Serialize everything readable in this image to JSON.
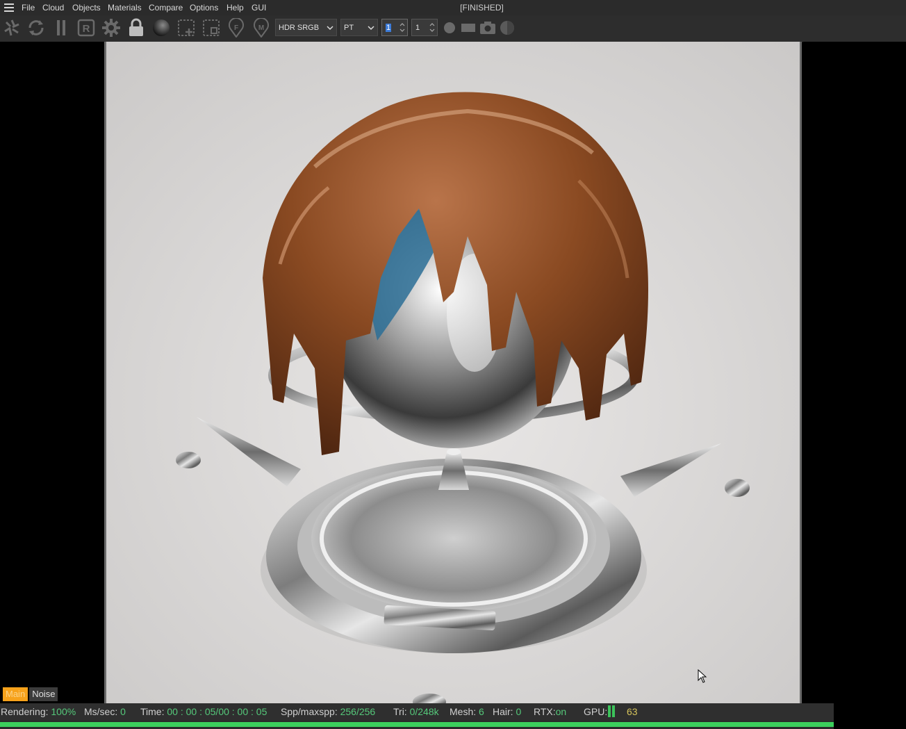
{
  "menu": {
    "items": [
      "File",
      "Cloud",
      "Objects",
      "Materials",
      "Compare",
      "Options",
      "Help",
      "GUI"
    ],
    "status": "[FINISHED]"
  },
  "toolbar": {
    "color_space": "HDR SRGB",
    "kernel": "PT",
    "spin1": "1",
    "spin2": "1"
  },
  "tabs": {
    "main": "Main",
    "noise": "Noise"
  },
  "status": {
    "rendering_label": "Rendering:",
    "rendering_val": "100%",
    "ms_label": "Ms/sec:",
    "ms_val": "0",
    "time_label": "Time:",
    "time_val": "00 : 00 : 05/00 : 00 : 05",
    "spp_label": "Spp/maxspp:",
    "spp_val": "256/256",
    "tri_label": "Tri:",
    "tri_val": "0/248k",
    "mesh_label": "Mesh:",
    "mesh_val": "6",
    "hair_label": "Hair:",
    "hair_val": "0",
    "rtx_label": "RTX:",
    "rtx_val": "on",
    "gpu_label": "GPU:",
    "gpu_val": "63"
  },
  "progress": 1.0,
  "colors": {
    "accent": "#f7a21b",
    "progress": "#3ccf5c",
    "value_green": "#55c87a",
    "chocolate": "#7a3f1c",
    "chrome": "#b8b8b8"
  },
  "icons": [
    "hamburger-menu-icon",
    "aperture-icon",
    "refresh-icon",
    "pause-icon",
    "r-region-icon",
    "gear-icon",
    "lock-icon",
    "sphere-icon",
    "add-region-icon",
    "crop-icon",
    "focus-picker-icon",
    "material-picker-icon",
    "dot-icon",
    "rect-icon",
    "camera-icon",
    "half-sphere-icon",
    "mouse-cursor-icon"
  ]
}
